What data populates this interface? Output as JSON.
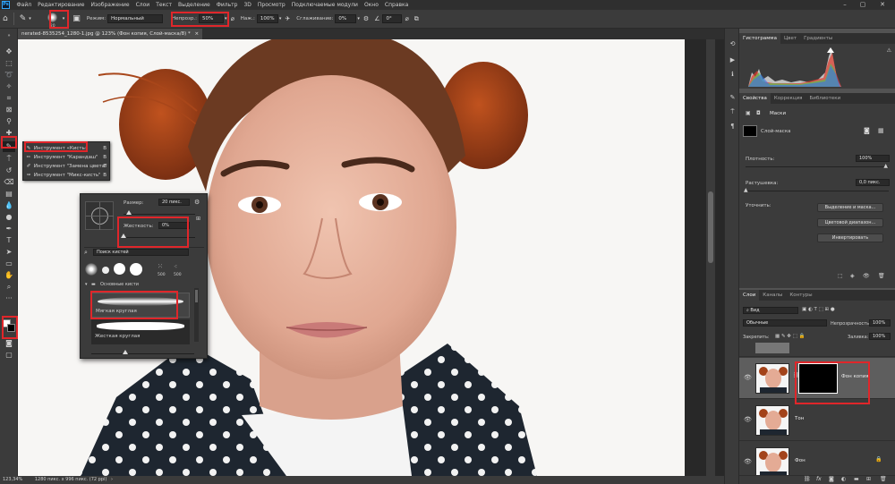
{
  "app": {
    "logo": "Ps"
  },
  "menu": [
    "Файл",
    "Редактирование",
    "Изображение",
    "Слои",
    "Текст",
    "Выделение",
    "Фильтр",
    "3D",
    "Просмотр",
    "Подключаемые модули",
    "Окно",
    "Справка"
  ],
  "options_bar": {
    "brush_size": "20",
    "mode_label": "Режим:",
    "mode_value": "Нормальный",
    "opacity_label": "Непрозр.:",
    "opacity_value": "50%",
    "flow_label": "Наж.:",
    "flow_value": "100%",
    "smoothing_label": "Сглаживание:",
    "smoothing_value": "0%",
    "angle_value": "0°"
  },
  "document": {
    "tab_title": "nerated-8535254_1280-1.jpg @ 123% (Фон копия, Слой-маска/8) *"
  },
  "status": {
    "zoom": "123,34%",
    "doc_size": "1280 пикс. x 996 пикс. (72 ppi)"
  },
  "tool_flyout": {
    "items": [
      {
        "label": "Инструмент «Кисть»",
        "key": "B"
      },
      {
        "label": "Инструмент \"Карандаш\"",
        "key": "B"
      },
      {
        "label": "Инструмент \"Замена цвета\"",
        "key": "B"
      },
      {
        "label": "Инструмент \"Микс-кисть\"",
        "key": "B"
      }
    ]
  },
  "brush_popup": {
    "size_label": "Размер:",
    "size_value": "20 пикс.",
    "hardness_label": "Жесткость:",
    "hardness_value": "0%",
    "hardness_percent": 0,
    "search_placeholder": "Поиск кистей",
    "presets": [
      "",
      "",
      "",
      "",
      "500",
      "500"
    ],
    "folder_label": "Основные кисти",
    "brushes": [
      "Мягкая круглая",
      "Жесткая круглая"
    ]
  },
  "histogram_panel": {
    "tabs": [
      "Гистограмма",
      "Цвет",
      "Градиенты"
    ]
  },
  "properties_panel": {
    "tabs": [
      "Свойства",
      "Коррекция",
      "Библиотеки"
    ],
    "section_title": "Маски",
    "mask_label": "Слой-маска",
    "density_label": "Плотность:",
    "density_value": "100%",
    "feather_label": "Растушевка:",
    "feather_value": "0,0 пикс.",
    "refine_label": "Уточнить:",
    "buttons": [
      "Выделение и маска...",
      "Цветовой диапазон...",
      "Инвертировать"
    ]
  },
  "layers_panel": {
    "tabs": [
      "Слои",
      "Каналы",
      "Контуры"
    ],
    "kind_label": "Вид",
    "blend_mode": "Обычные",
    "opacity_label": "Непрозрачность:",
    "opacity_value": "100%",
    "lock_label": "Закрепить:",
    "fill_label": "Заливка:",
    "fill_value": "100%",
    "layers": [
      {
        "name": "Фон копия",
        "has_mask": true,
        "selected": true
      },
      {
        "name": "Тон",
        "has_mask": false,
        "selected": false
      },
      {
        "name": "Фон",
        "has_mask": false,
        "selected": false
      }
    ]
  },
  "colors": {
    "highlight": "#e0262a",
    "panel_bg": "#3b3b3b",
    "menu_bg": "#2f2f2f",
    "workspace": "#535353"
  },
  "icons": [
    "home-icon",
    "brush-tool-icon",
    "move-icon",
    "marquee-icon",
    "lasso-icon",
    "crop-icon",
    "eyedropper-icon",
    "healing-icon",
    "brush-icon",
    "stamp-icon",
    "history-brush-icon",
    "eraser-icon",
    "gradient-icon",
    "blur-icon",
    "dodge-icon",
    "pen-icon",
    "text-icon",
    "path-select-icon",
    "rectangle-icon",
    "hand-icon",
    "zoom-icon",
    "more-icon",
    "color-swatches",
    "quick-mask-icon",
    "screen-mode-icon",
    "eye-icon",
    "gear-icon",
    "search-icon"
  ]
}
